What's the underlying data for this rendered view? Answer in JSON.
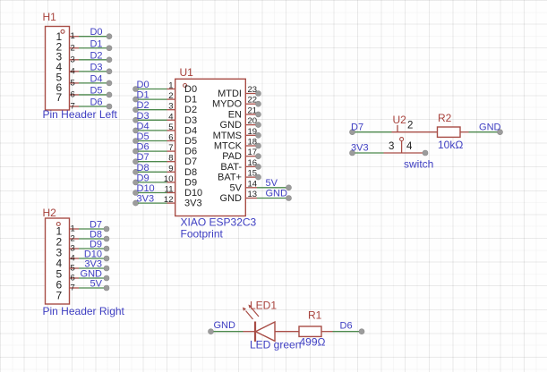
{
  "colors": {
    "symbol": "#a84d46",
    "label_red": "#a8423c",
    "net_blue": "#3e3ec2",
    "pin_text": "#222222",
    "wire_green": "#4c884c",
    "dot_gray": "#9c9c9c"
  },
  "schematic": {
    "h1": {
      "ref": "H1",
      "value": "Pin Header Left",
      "pad_numbers": [
        "1",
        "2",
        "3",
        "4",
        "5",
        "6",
        "7"
      ],
      "pin_numbers": [
        "1",
        "2",
        "3",
        "4",
        "5",
        "6",
        "7"
      ],
      "nets": [
        "D0",
        "D1",
        "D2",
        "D3",
        "D4",
        "D5",
        "D6"
      ]
    },
    "h2": {
      "ref": "H2",
      "value": "Pin Header Right",
      "pad_numbers": [
        "1",
        "2",
        "3",
        "4",
        "5",
        "6",
        "7"
      ],
      "pin_numbers": [
        "1",
        "2",
        "3",
        "4",
        "5",
        "6",
        "7"
      ],
      "nets": [
        "D7",
        "D8",
        "D9",
        "D10",
        "3V3",
        "GND",
        "5V"
      ]
    },
    "u1": {
      "ref": "U1",
      "value_line1": "XIAO ESP32C3",
      "value_line2": "Footprint",
      "left_numbers": [
        "1",
        "2",
        "3",
        "4",
        "5",
        "6",
        "7",
        "8",
        "9",
        "10",
        "11",
        "12"
      ],
      "left_names": [
        "D0",
        "D1",
        "D2",
        "D3",
        "D4",
        "D5",
        "D6",
        "D7",
        "D8",
        "D9",
        "D10",
        "3V3"
      ],
      "left_nets": [
        "D0",
        "D1",
        "D2",
        "D3",
        "D4",
        "D5",
        "D6",
        "D7",
        "D8",
        "D9",
        "D10",
        "3V3"
      ],
      "right_numbers": [
        "23",
        "22",
        "21",
        "20",
        "19",
        "18",
        "17",
        "16",
        "15",
        "14",
        "13"
      ],
      "right_names": [
        "MTDI",
        "MYDO",
        "EN",
        "GND",
        "MTMS",
        "MTCK",
        "PAD",
        "BAT-",
        "BAT+",
        "5V",
        "GND"
      ],
      "right_nets": [
        null,
        null,
        null,
        null,
        null,
        null,
        null,
        null,
        null,
        "5V",
        "GND"
      ]
    },
    "u2": {
      "ref": "U2",
      "value": "switch",
      "pin_numbers": {
        "p2": "2",
        "p3": "3",
        "p4": "4"
      },
      "net_top": "D7",
      "net_bottom": "3V3"
    },
    "r2": {
      "ref": "R2",
      "value": "10kΩ",
      "net": "GND"
    },
    "r1": {
      "ref": "R1",
      "value": "499Ω",
      "net": "D6"
    },
    "led1": {
      "ref": "LED1",
      "value": "LED green",
      "net": "GND"
    }
  }
}
